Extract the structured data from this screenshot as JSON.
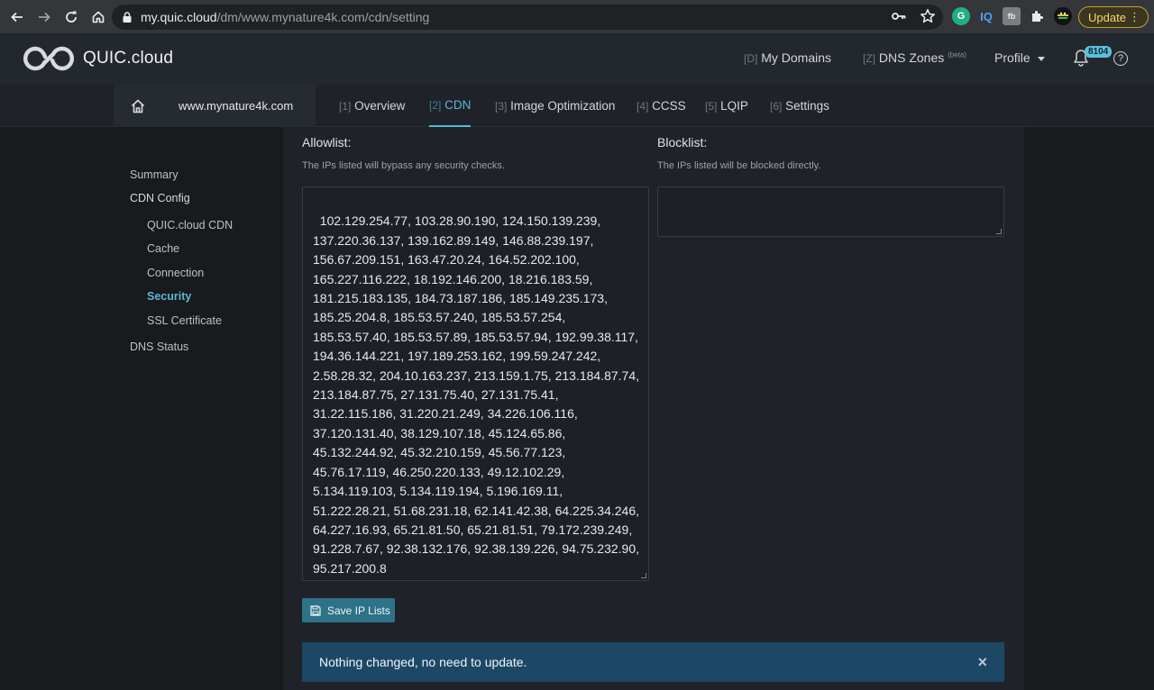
{
  "browser": {
    "url_host": "my.quic.cloud",
    "url_path": "/dm/www.mynature4k.com/cdn/setting",
    "extensions": [
      "G",
      "IQ",
      "fb"
    ],
    "update_label": "Update",
    "colors": {
      "update_border": "#c9a227",
      "update_text": "#fdd663"
    }
  },
  "header": {
    "logo_text": "QUIC.cloud",
    "nav": [
      {
        "key": "[D]",
        "label": "My Domains"
      },
      {
        "key": "[Z]",
        "label": "DNS Zones",
        "sup": "(beta)"
      },
      {
        "label": "Profile"
      }
    ],
    "notification_count": "8104",
    "help_glyph": "?"
  },
  "subnav": {
    "domain": "www.mynature4k.com",
    "tabs": [
      {
        "key": "[1]",
        "label": "Overview"
      },
      {
        "key": "[2]",
        "label": "CDN"
      },
      {
        "key": "[3]",
        "label": "Image Optimization"
      },
      {
        "key": "[4]",
        "label": "CCSS"
      },
      {
        "key": "[5]",
        "label": "LQIP"
      },
      {
        "key": "[6]",
        "label": "Settings"
      }
    ],
    "active_tab": "CDN",
    "accent_color": "#58b7d6"
  },
  "sidebar": {
    "summary": "Summary",
    "cdn_config": "CDN Config",
    "children": [
      "QUIC.cloud CDN",
      "Cache",
      "Connection",
      "Security",
      "SSL Certificate"
    ],
    "active": "Security",
    "dns_status": "DNS Status"
  },
  "allowlist": {
    "title": "Allowlist:",
    "hint": "The IPs listed will bypass any security checks.",
    "value": "102.129.254.77, 103.28.90.190, 124.150.139.239,\n137.220.36.137, 139.162.89.149, 146.88.239.197,\n156.67.209.151, 163.47.20.24, 164.52.202.100,\n165.227.116.222, 18.192.146.200, 18.216.183.59,\n181.215.183.135, 184.73.187.186, 185.149.235.173,\n185.25.204.8, 185.53.57.240, 185.53.57.254,\n185.53.57.40, 185.53.57.89, 185.53.57.94, 192.99.38.117,\n194.36.144.221, 197.189.253.162, 199.59.247.242,\n2.58.28.32, 204.10.163.237, 213.159.1.75, 213.184.87.74,\n213.184.87.75, 27.131.75.40, 27.131.75.41,\n31.22.115.186, 31.220.21.249, 34.226.106.116,\n37.120.131.40, 38.129.107.18, 45.124.65.86,\n45.132.244.92, 45.32.210.159, 45.56.77.123,\n45.76.17.119, 46.250.220.133, 49.12.102.29,\n5.134.119.103, 5.134.119.194, 5.196.169.11,\n51.222.28.21, 51.68.231.18, 62.141.42.38, 64.225.34.246,\n64.227.16.93, 65.21.81.50, 65.21.81.51, 79.172.239.249,\n91.228.7.67, 92.38.132.176, 92.38.139.226, 94.75.232.90,\n95.217.200.8"
  },
  "blocklist": {
    "title": "Blocklist:",
    "hint": "The IPs listed will be blocked directly.",
    "value": ""
  },
  "save_button": {
    "label": "Save IP Lists",
    "color": "#2e7288"
  },
  "alert": {
    "message": "Nothing changed, no need to update.",
    "close_glyph": "×",
    "color": "#1c4866"
  }
}
